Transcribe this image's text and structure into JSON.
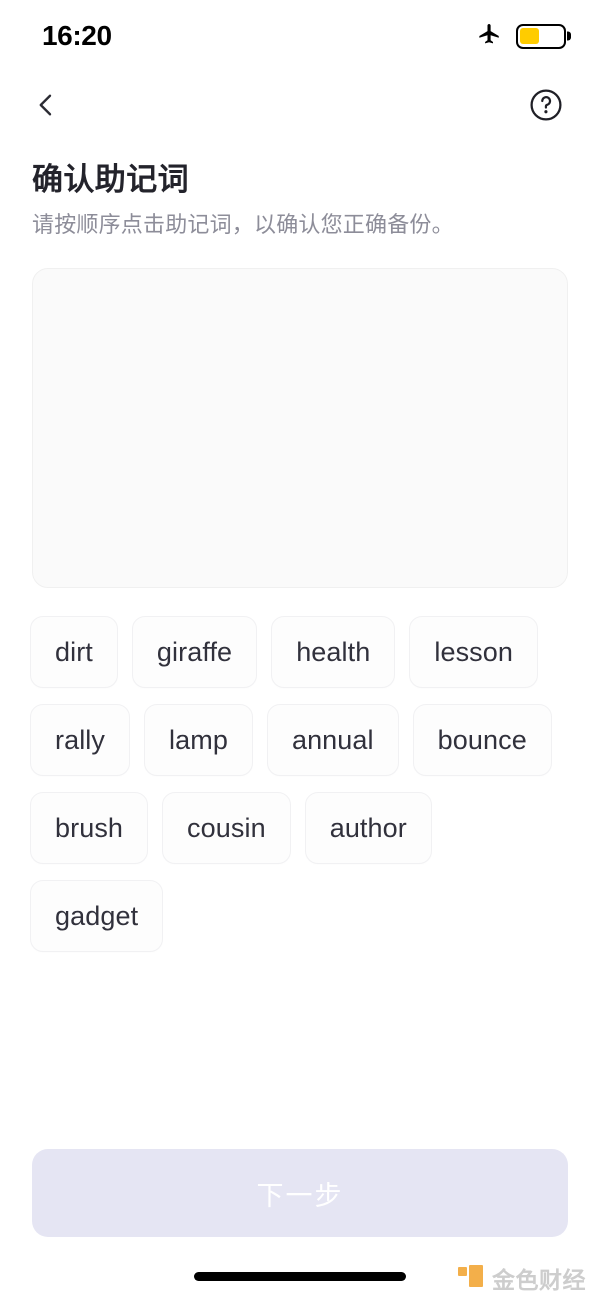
{
  "status_bar": {
    "time": "16:20",
    "airplane_icon": "airplane-icon",
    "battery_icon": "battery-icon",
    "battery_level_percent": 45,
    "battery_color": "#FFCC00"
  },
  "nav_bar": {
    "back_icon": "chevron-left-icon",
    "help_icon": "question-circle-icon"
  },
  "heading": {
    "title": "确认助记词",
    "subtitle": "请按顺序点击助记词，以确认您正确备份。"
  },
  "answer_area": {
    "selected_words": [],
    "placeholder": ""
  },
  "word_bank": {
    "words": [
      "dirt",
      "giraffe",
      "health",
      "lesson",
      "rally",
      "lamp",
      "annual",
      "bounce",
      "brush",
      "cousin",
      "author",
      "gadget"
    ]
  },
  "footer": {
    "next_button_label": "下一步",
    "next_button_disabled": true,
    "next_button_bg": "#E5E5F3",
    "next_button_text_color": "#FFFFFF"
  },
  "watermark": {
    "text": "金色财经",
    "logo_color": "#F2A93B"
  },
  "theme": {
    "page_bg": "#FFFFFF",
    "title_color": "#23232B",
    "subtitle_color": "#8D8D99",
    "chip_bg": "#FDFDFD",
    "chip_border": "#F1F1F3",
    "chip_text": "#31313C",
    "answer_area_bg": "#FAFAFA"
  }
}
